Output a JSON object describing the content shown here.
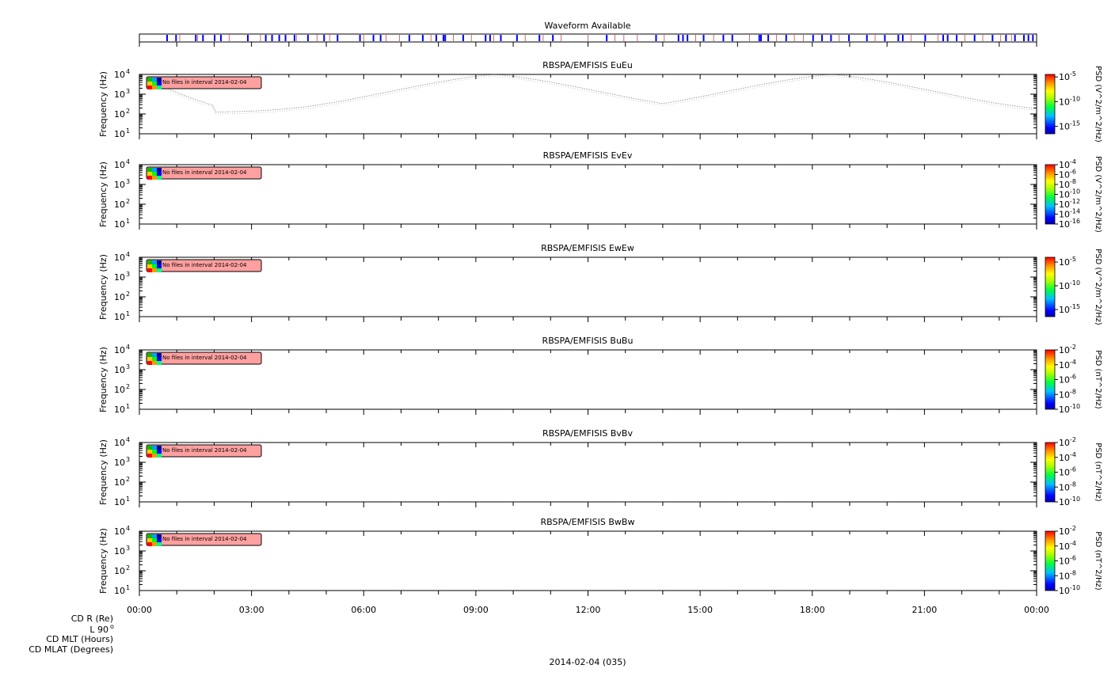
{
  "waveform": {
    "title": "Waveform Available",
    "blue_lines": [
      0.03,
      0.04,
      0.062,
      0.07,
      0.083,
      0.09,
      0.12,
      0.14,
      0.147,
      0.155,
      0.162,
      0.172,
      0.187,
      0.205,
      0.22,
      0.245,
      0.26,
      0.268,
      0.3,
      0.315,
      0.33,
      0.338,
      0.34,
      0.36,
      0.385,
      0.39,
      0.402,
      0.42,
      0.445,
      0.46,
      0.52,
      0.575,
      0.6,
      0.605,
      0.61,
      0.628,
      0.65,
      0.66,
      0.69,
      0.692,
      0.7,
      0.72,
      0.75,
      0.76,
      0.77,
      0.79,
      0.81,
      0.83,
      0.845,
      0.85,
      0.875,
      0.895,
      0.9,
      0.91,
      0.93,
      0.95,
      0.965,
      0.975,
      0.985,
      0.99,
      0.995
    ],
    "red_lines": [
      0.045,
      0.065,
      0.1,
      0.135,
      0.175,
      0.198,
      0.212,
      0.25,
      0.275,
      0.29,
      0.325,
      0.35,
      0.37,
      0.395,
      0.43,
      0.45,
      0.47,
      0.5,
      0.53,
      0.54,
      0.555,
      0.585,
      0.62,
      0.64,
      0.68,
      0.71,
      0.73,
      0.74,
      0.78,
      0.82,
      0.86,
      0.89,
      0.92,
      0.94,
      0.96,
      0.972
    ]
  },
  "notice": "No files in interval 2014-02-04",
  "ylabel": "Frequency (Hz)",
  "yticks": [
    "10",
    "10",
    "10",
    "10"
  ],
  "yexps": [
    "1",
    "2",
    "3",
    "4"
  ],
  "xticks": [
    "00:00",
    "03:00",
    "06:00",
    "09:00",
    "12:00",
    "15:00",
    "18:00",
    "21:00",
    "00:00"
  ],
  "xlabel": "2014-02-04 (035)",
  "orbit_labels": [
    "CD R (Re)",
    "L 90",
    "CD MLT (Hours)",
    "CD MLAT (Degrees)"
  ],
  "orbit_label_sup": "o",
  "chart_data": [
    {
      "type": "heatmap",
      "title": "RBSPA/EMFISIS  EuEu",
      "ylim": [
        10,
        10000
      ],
      "yscale": "log",
      "cbar_label": "PSD (V^2/m^2/Hz)",
      "cbar_ticks": [
        {
          "base": "10",
          "exp": "-5",
          "value": -5
        },
        {
          "base": "10",
          "exp": "-10",
          "value": -10
        },
        {
          "base": "10",
          "exp": "-15",
          "value": -15
        }
      ],
      "cbar_range": [
        -16.5,
        -4.5
      ],
      "trace": true
    },
    {
      "type": "heatmap",
      "title": "RBSPA/EMFISIS  EvEv",
      "ylim": [
        10,
        10000
      ],
      "yscale": "log",
      "cbar_label": "PSD (V^2/m^2/Hz)",
      "cbar_ticks": [
        {
          "base": "10",
          "exp": "-4",
          "value": -4
        },
        {
          "base": "10",
          "exp": "-6",
          "value": -6
        },
        {
          "base": "10",
          "exp": "-8",
          "value": -8
        },
        {
          "base": "10",
          "exp": "-10",
          "value": -10
        },
        {
          "base": "10",
          "exp": "-12",
          "value": -12
        },
        {
          "base": "10",
          "exp": "-14",
          "value": -14
        },
        {
          "base": "10",
          "exp": "-16",
          "value": -16
        }
      ],
      "cbar_range": [
        -16,
        -4
      ],
      "trace": false
    },
    {
      "type": "heatmap",
      "title": "RBSPA/EMFISIS  EwEw",
      "ylim": [
        10,
        10000
      ],
      "yscale": "log",
      "cbar_label": "PSD (V^2/m^2/Hz)",
      "cbar_ticks": [
        {
          "base": "10",
          "exp": "-5",
          "value": -5
        },
        {
          "base": "10",
          "exp": "-10",
          "value": -10
        },
        {
          "base": "10",
          "exp": "-15",
          "value": -15
        }
      ],
      "cbar_range": [
        -16.5,
        -4
      ],
      "trace": false
    },
    {
      "type": "heatmap",
      "title": "RBSPA/EMFISIS  BuBu",
      "ylim": [
        10,
        10000
      ],
      "yscale": "log",
      "cbar_label": "PSD (nT^2/Hz)",
      "cbar_ticks": [
        {
          "base": "10",
          "exp": "-2",
          "value": -2
        },
        {
          "base": "10",
          "exp": "-4",
          "value": -4
        },
        {
          "base": "10",
          "exp": "-6",
          "value": -6
        },
        {
          "base": "10",
          "exp": "-8",
          "value": -8
        },
        {
          "base": "10",
          "exp": "-10",
          "value": -10
        }
      ],
      "cbar_range": [
        -10,
        -2
      ],
      "trace": false
    },
    {
      "type": "heatmap",
      "title": "RBSPA/EMFISIS  BvBv",
      "ylim": [
        10,
        10000
      ],
      "yscale": "log",
      "cbar_label": "PSD (nT^2/Hz)",
      "cbar_ticks": [
        {
          "base": "10",
          "exp": "-2",
          "value": -2
        },
        {
          "base": "10",
          "exp": "-4",
          "value": -4
        },
        {
          "base": "10",
          "exp": "-6",
          "value": -6
        },
        {
          "base": "10",
          "exp": "-8",
          "value": -8
        },
        {
          "base": "10",
          "exp": "-10",
          "value": -10
        }
      ],
      "cbar_range": [
        -10,
        -2
      ],
      "trace": false
    },
    {
      "type": "heatmap",
      "title": "RBSPA/EMFISIS  BwBw",
      "ylim": [
        10,
        10000
      ],
      "yscale": "log",
      "cbar_label": "PSD (nT^2/Hz)",
      "cbar_ticks": [
        {
          "base": "10",
          "exp": "-2",
          "value": -2
        },
        {
          "base": "10",
          "exp": "-4",
          "value": -4
        },
        {
          "base": "10",
          "exp": "-6",
          "value": -6
        },
        {
          "base": "10",
          "exp": "-8",
          "value": -8
        },
        {
          "base": "10",
          "exp": "-10",
          "value": -10
        }
      ],
      "cbar_range": [
        -10,
        -2
      ],
      "trace": false
    }
  ]
}
